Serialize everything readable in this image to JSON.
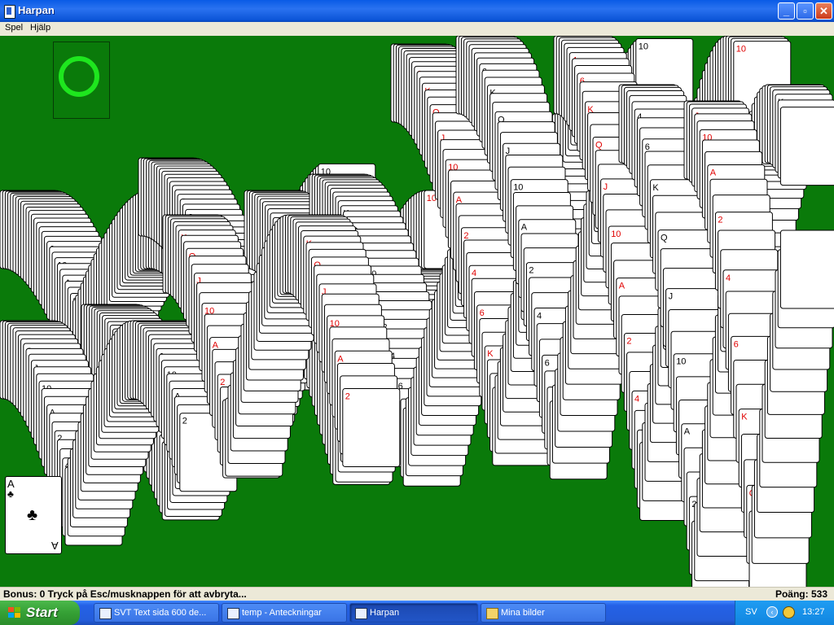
{
  "window": {
    "title": "Harpan",
    "minimize_glyph": "_",
    "maximize_glyph": "▫",
    "close_glyph": "✕"
  },
  "menu": [
    "Spel",
    "Hjälp"
  ],
  "foundation": {
    "icon": "circle-icon",
    "color": "#1ee61e"
  },
  "table_color": "#0a7a0a",
  "cascade": {
    "description_colors": [
      "#000000",
      "#e00000"
    ],
    "visible_card": {
      "rank": "A",
      "suit": "♣",
      "color": "#000000"
    },
    "repeated_ranks": [
      "A",
      "2",
      "4",
      "6",
      "K",
      "Q",
      "J",
      "10"
    ]
  },
  "status": {
    "message": "Bonus: 0  Tryck på Esc/musknappen för att avbryta...",
    "score": "Poäng: 533"
  },
  "taskbar": {
    "start_label": "Start",
    "tasks": [
      {
        "label": "SVT Text sida 600 de...",
        "icon": "browser-icon",
        "active": false
      },
      {
        "label": "temp - Anteckningar",
        "icon": "notepad-icon",
        "active": false
      },
      {
        "label": "Harpan",
        "icon": "solitaire-icon",
        "active": true
      },
      {
        "label": "Mina bilder",
        "icon": "folder-icon",
        "active": false
      }
    ],
    "tray": {
      "language": "SV",
      "clock": "13:27"
    }
  }
}
